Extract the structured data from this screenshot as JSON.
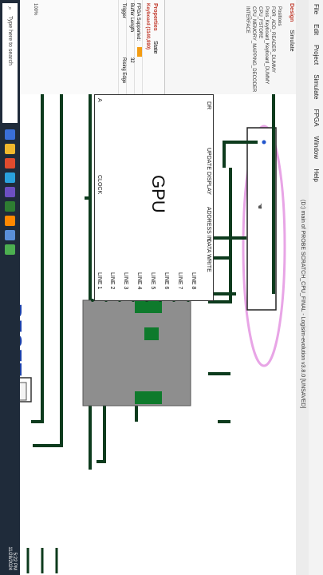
{
  "menu": [
    "File",
    "Edit",
    "Project",
    "Simulate",
    "FPGA",
    "Window",
    "Help"
  ],
  "window_title": "(D:) main of PROBE SCRATCH_CPU_FINAL - Logisim-evolution v3.8.0 [UNSAVED]",
  "panel_tabs": [
    "Design",
    "Simulate"
  ],
  "tree": [
    "Positions",
    "FOR_ADD_READER_DUMMY",
    "Poss_Keyboard_Keyboard_DUMMY",
    "CPU_FSTORE",
    "CPU_MEMORY_MAPPING_DECODER",
    "INTERFACE"
  ],
  "properties": {
    "tabs": [
      "Properties",
      "State"
    ],
    "component": "Keyboard (1140,890)",
    "rows": [
      {
        "label": "FPGA Supported:",
        "value": ""
      },
      {
        "label": "Buffer Length",
        "value": "32"
      },
      {
        "label": "Trigger",
        "value": "Rising Edge"
      }
    ]
  },
  "gpu": {
    "title": "GPU",
    "left_pins": [
      "DR",
      "UPDATE DISPLAY",
      "ADDRESS IN",
      "DATA WRITE"
    ],
    "right_pins": [
      "A",
      "CLOCK"
    ],
    "bottom_pins": [
      "LINE 1",
      "LINE 2",
      "LINE 3",
      "LINE 4",
      "LINE 5",
      "LINE 6",
      "LINE 7",
      "LINE 8"
    ],
    "left_pin_top_label": "A"
  },
  "reset_label": "RESET",
  "zoom_label": "100%",
  "taskbar": {
    "search_placeholder": "Type here to search",
    "time": "5:22 PM",
    "date": "11/28/2024"
  },
  "colors": {
    "wire": "#0d3b1d",
    "highlight": "#e8a5e6",
    "reset_text": "#1a3fa8",
    "display_bg": "#8e8e8e",
    "pixel_on": "#0e7a2c"
  }
}
